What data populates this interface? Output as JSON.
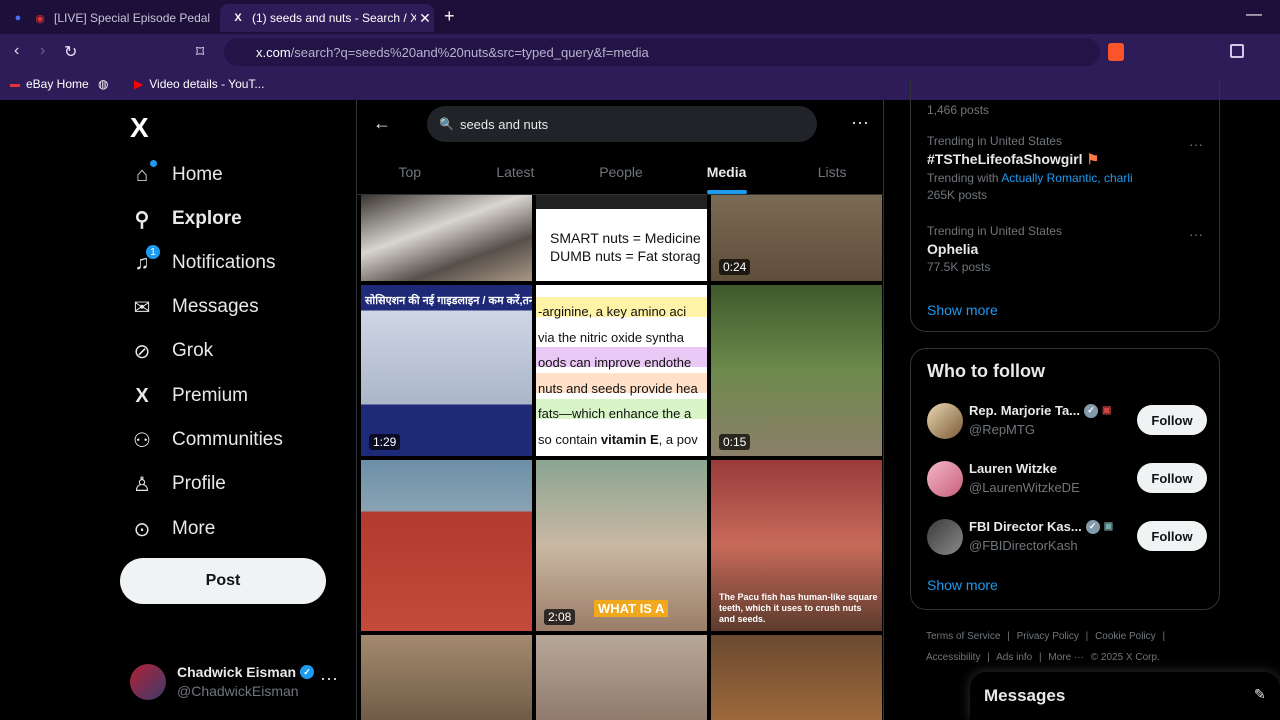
{
  "browser": {
    "tabs": [
      {
        "title": "[LIVE] Special Episode Pedal T"
      },
      {
        "title": "(1) seeds and nuts - Search / X"
      }
    ],
    "new_tab": "+",
    "minimize": "—",
    "url_host": "x.com",
    "url_rest": "/search?q=seeds%20and%20nuts&src=typed_query&f=media",
    "bookmarks": [
      "eBay Home",
      "Video details - YouT..."
    ]
  },
  "nav": {
    "logo": "X",
    "items": [
      {
        "label": "Home",
        "icon": "home-icon",
        "glyph": "⌂"
      },
      {
        "label": "Explore",
        "icon": "search-icon",
        "glyph": "⚲"
      },
      {
        "label": "Notifications",
        "icon": "bell-icon",
        "glyph": "🔔",
        "badge": "1"
      },
      {
        "label": "Messages",
        "icon": "envelope-icon",
        "glyph": "✉"
      },
      {
        "label": "Grok",
        "icon": "grok-icon",
        "glyph": "⊘"
      },
      {
        "label": "Premium",
        "icon": "x-icon",
        "glyph": "X"
      },
      {
        "label": "Communities",
        "icon": "communities-icon",
        "glyph": "👥"
      },
      {
        "label": "Profile",
        "icon": "person-icon",
        "glyph": "👤"
      },
      {
        "label": "More",
        "icon": "more-circle-icon",
        "glyph": "⋯"
      }
    ],
    "post_label": "Post",
    "account": {
      "name": "Chadwick Eisman",
      "handle": "@ChadwickEisman",
      "more": "···"
    }
  },
  "search": {
    "query": "seeds and nuts",
    "tabs": [
      "Top",
      "Latest",
      "People",
      "Media",
      "Lists"
    ],
    "active_tab": "Media"
  },
  "media": [
    {
      "caption": "",
      "duration": ""
    },
    {
      "caption": "SMART nuts = Medicine\nDUMB nuts = Fat storag",
      "duration": ""
    },
    {
      "caption": "",
      "duration": "0:24"
    },
    {
      "caption": "सोसिएशन की नई गाइडलाइन / कम करें,तनाव घटाएं",
      "duration": "1:29"
    },
    {
      "caption": "-arginine, a key amino aci / via the nitric oxide syntha / oods can improve endothe / nuts and seeds provide hea / fats—which enhance the a / so contain vitamin E, a pov",
      "duration": ""
    },
    {
      "caption": "",
      "duration": "0:15"
    },
    {
      "caption": "",
      "duration": ""
    },
    {
      "caption": "WHAT IS A",
      "duration": "2:08"
    },
    {
      "caption": "The Pacu fish has human-like square teeth, which it uses to crush nuts and seeds.",
      "duration": ""
    },
    {
      "caption": "",
      "duration": ""
    },
    {
      "caption": "",
      "duration": ""
    },
    {
      "caption": "",
      "duration": ""
    }
  ],
  "sidebar": {
    "top_posts": "1,466 posts",
    "trends": [
      {
        "context": "Trending in United States",
        "title": "#TSTheLifeofaShowgirl",
        "sub_prefix": "Trending with ",
        "links": "Actually Romantic, charli",
        "posts": "265K posts"
      },
      {
        "context": "Trending in United States",
        "title": "Ophelia",
        "posts": "77.5K posts"
      }
    ],
    "show_more": "Show more",
    "who_to_follow": "Who to follow",
    "users": [
      {
        "name": "Rep. Marjorie Ta...",
        "handle": "@RepMTG",
        "follow": "Follow"
      },
      {
        "name": "Lauren Witzke",
        "handle": "@LaurenWitzkeDE",
        "follow": "Follow"
      },
      {
        "name": "FBI Director Kas...",
        "handle": "@FBIDirectorKash",
        "follow": "Follow"
      }
    ],
    "footer": [
      "Terms of Service",
      "|",
      "Privacy Policy",
      "|",
      "Cookie Policy",
      "|",
      "Accessibility",
      "|",
      "Ads info",
      "|",
      "More ···",
      "© 2025 X Corp."
    ]
  },
  "messages_drawer": {
    "title": "Messages"
  }
}
